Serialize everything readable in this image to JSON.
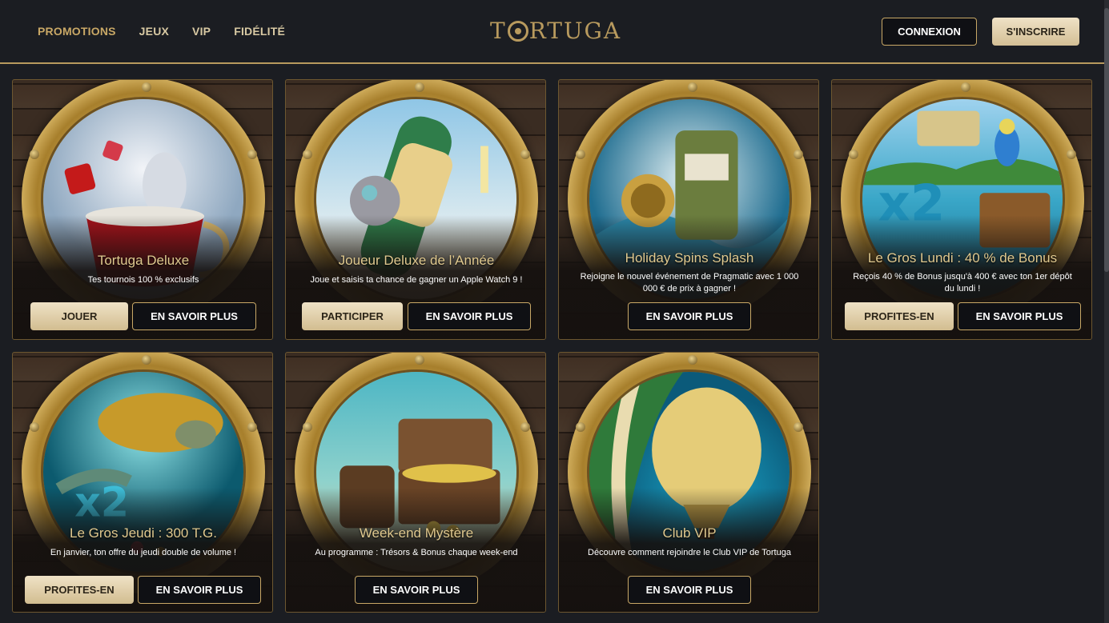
{
  "nav": {
    "items": [
      "PROMOTIONS",
      "JEUX",
      "VIP",
      "FIDÉLITÉ"
    ]
  },
  "logo": {
    "text_left": "T",
    "text_right": "RTUGA"
  },
  "auth": {
    "login_label": "CONNEXION",
    "signup_label": "S'INSCRIRE"
  },
  "colors": {
    "gold": "#c9a866",
    "background": "#1b1d22",
    "card_border": "#6d5730"
  },
  "cards": [
    {
      "title": "Tortuga Deluxe",
      "description": "Tes tournois 100 % exclusifs",
      "primary_label": "JOUER",
      "secondary_label": "EN SAVOIR PLUS",
      "art": "teacup-rabbit-dice"
    },
    {
      "title": "Joueur Deluxe de l’Année",
      "description": "Joue et saisis ta chance de gagner un Apple Watch 9 !",
      "primary_label": "PARTICIPER",
      "secondary_label": "EN SAVOIR PLUS",
      "art": "monkey-smartwatch"
    },
    {
      "title": "Holiday Spins Splash",
      "description": "Rejoigne le nouvel événement de Pragmatic avec 1 000 000 € de prix à gagner !",
      "primary_label": "",
      "secondary_label": "EN SAVOIR PLUS",
      "art": "slot-machine-wave"
    },
    {
      "title": "Le Gros Lundi : 40 % de Bonus",
      "description": "Reçois 40 % de Bonus jusqu'à 400 € avec ton 1er dépôt du lundi !",
      "primary_label": "PROFITES-EN",
      "secondary_label": "EN SAVOIR PLUS",
      "art": "x2-parrot-treasure"
    },
    {
      "title": "Le Gros Jeudi : 300 T.G.",
      "description": "En janvier, ton offre du jeudi double de volume !",
      "primary_label": "PROFITES-EN",
      "secondary_label": "EN SAVOIR PLUS",
      "art": "sea-turtle-x2"
    },
    {
      "title": "Week-end Mystère",
      "description": "Au programme : Trésors & Bonus chaque week-end",
      "primary_label": "",
      "secondary_label": "EN SAVOIR PLUS",
      "art": "treasure-chest"
    },
    {
      "title": "Club VIP",
      "description": "Découvre comment rejoindre le Club VIP de Tortuga",
      "primary_label": "",
      "secondary_label": "EN SAVOIR PLUS",
      "art": "hot-air-balloon"
    }
  ]
}
